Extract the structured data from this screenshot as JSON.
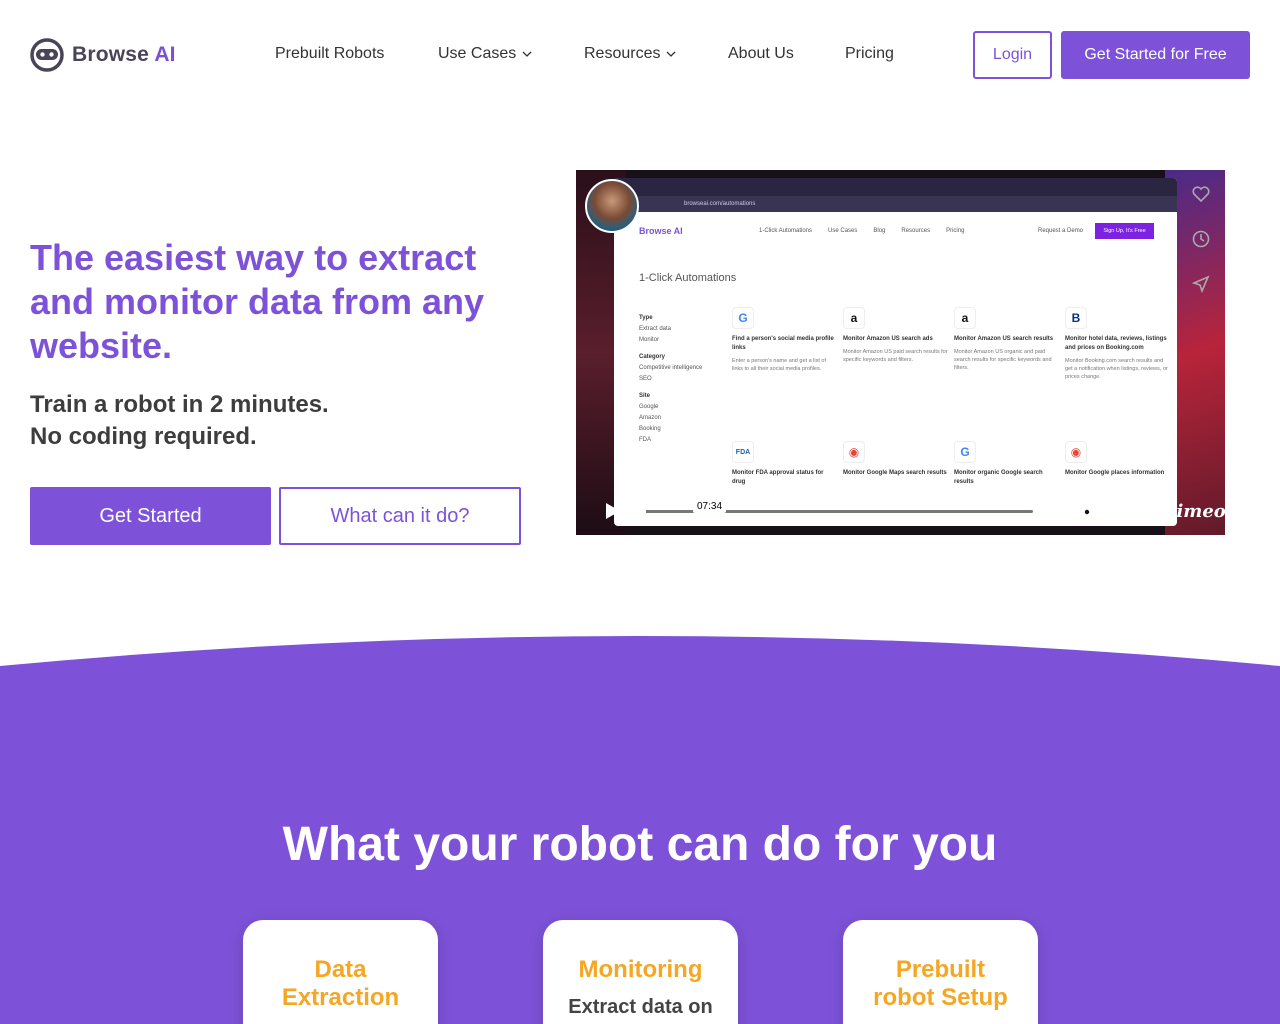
{
  "brand": {
    "name": "Browse",
    "name_ai": " AI"
  },
  "nav": {
    "items": [
      {
        "label": "Prebuilt Robots",
        "dropdown": false
      },
      {
        "label": "Use Cases",
        "dropdown": true
      },
      {
        "label": "Resources",
        "dropdown": true
      },
      {
        "label": "About Us",
        "dropdown": false
      },
      {
        "label": "Pricing",
        "dropdown": false
      }
    ],
    "login_label": "Login",
    "cta_label": "Get Started for Free"
  },
  "hero": {
    "title": "The easiest way to extract and monitor data from any website.",
    "subtitle_line1": "Train a robot in 2 minutes.",
    "subtitle_line2": "No coding required.",
    "primary_button": "Get Started",
    "secondary_button": "What can it do?"
  },
  "video": {
    "url_text": "browseai.com/automations",
    "site_brand": "Browse AI",
    "site_nav": [
      "1-Click Automations",
      "Use Cases",
      "Blog",
      "Resources",
      "Pricing"
    ],
    "site_demo": "Request a Demo",
    "site_signup": "Sign Up, It's Free",
    "site_heading": "1-Click Automations",
    "side_sections": [
      {
        "heading": "Type",
        "items": [
          "Extract data",
          "Monitor"
        ]
      },
      {
        "heading": "Category",
        "items": [
          "Competitive intelligence",
          "SEO"
        ]
      },
      {
        "heading": "Site",
        "items": [
          "Google",
          "Amazon",
          "Booking",
          "FDA"
        ]
      }
    ],
    "cards": [
      {
        "logo": "G",
        "logo_color": "#4285F4",
        "title": "Find a person's social media profile links",
        "desc": "Enter a person's name and get a list of links to all their social media profiles."
      },
      {
        "logo": "a",
        "logo_color": "#111111",
        "title": "Monitor Amazon US search ads",
        "desc": "Monitor Amazon US paid search results for specific keywords and filters."
      },
      {
        "logo": "a",
        "logo_color": "#111111",
        "title": "Monitor Amazon US search results",
        "desc": "Monitor Amazon US organic and paid search results for specific keywords and filters."
      },
      {
        "logo": "B",
        "logo_color": "#003580",
        "title": "Monitor hotel data, reviews, listings and prices on Booking.com",
        "desc": "Monitor Booking.com search results and get a notification when listings, reviews, or prices change."
      },
      {
        "logo": "FDA",
        "logo_color": "#1a5fb4",
        "title": "Monitor FDA approval status for drug",
        "desc": ""
      },
      {
        "logo": "◉",
        "logo_color": "#EA4335",
        "title": "Monitor Google Maps search results",
        "desc": ""
      },
      {
        "logo": "G",
        "logo_color": "#4285F4",
        "title": "Monitor organic Google search results",
        "desc": ""
      },
      {
        "logo": "◉",
        "logo_color": "#EA4335",
        "title": "Monitor Google places information",
        "desc": ""
      }
    ],
    "time": "07:34",
    "progress_percent": 1,
    "player_brand": "vimeo"
  },
  "features_section": {
    "title": "What your robot can do for you",
    "cards": [
      {
        "title": "Data Extraction",
        "desc": ""
      },
      {
        "title": "Monitoring",
        "desc": "Extract data on"
      },
      {
        "title": "Prebuilt robot Setup",
        "desc": ""
      }
    ]
  },
  "colors": {
    "accent": "#7d52d8",
    "feature_title": "#f5a623",
    "section_bg": "#7d52d8"
  }
}
